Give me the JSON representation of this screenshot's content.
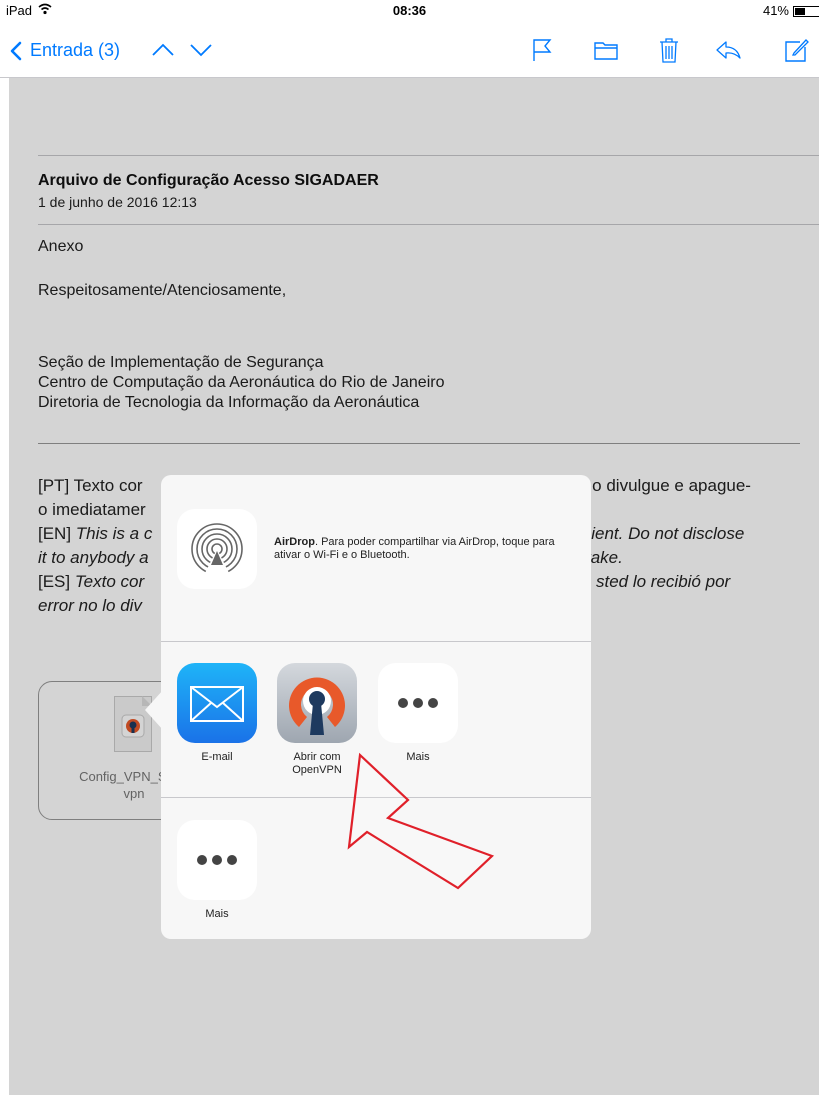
{
  "status_bar": {
    "carrier": "iPad",
    "time": "08:36",
    "battery": "41%"
  },
  "nav": {
    "back_label": "Entrada (3)",
    "icons": [
      "chevron-left-icon",
      "chevron-up-icon",
      "chevron-down-icon",
      "flag-icon",
      "folder-icon",
      "trash-icon",
      "reply-icon",
      "compose-icon"
    ]
  },
  "email": {
    "subject": "Arquivo de Configuração Acesso SIGADAER",
    "date": "1 de junho de 2016 12:13",
    "body": [
      "Anexo",
      "Respeitosamente/Atenciosamente,"
    ],
    "signature": [
      "Seção de Implementação de Segurança",
      "Centro de Computação da Aeronáutica do Rio de Janeiro",
      "Diretoria de Tecnologia da Informação da Aeronáutica"
    ],
    "disclaimer": {
      "pt_1": "[PT] Texto cor",
      "pt_right": "o o divulgue e apague-",
      "pt_2": "o imediatamer",
      "en_tag": "[EN]",
      "en_1": "This is a c",
      "en_right": "ipient. Do not disclose",
      "en_2": "it to anybody a",
      "en_right2": "take.",
      "es_tag": "[ES]",
      "es_1": "Texto cor",
      "es_right": "sted lo recibió por",
      "es_2": "error no lo div"
    },
    "attachment": {
      "name_line1": "Config_VPN_SIGA",
      "name_line2": "vpn"
    }
  },
  "share_sheet": {
    "airdrop_title": "AirDrop",
    "airdrop_text": ". Para poder compartilhar via AirDrop, toque para ativar o Wi-Fi e o Bluetooth.",
    "apps": [
      {
        "label": "E-mail",
        "icon": "mail-icon"
      },
      {
        "label_line1": "Abrir com",
        "label_line2": "OpenVPN",
        "icon": "openvpn-icon"
      },
      {
        "label": "Mais",
        "icon": "more-icon"
      }
    ],
    "actions": [
      {
        "label": "Mais",
        "icon": "more-icon"
      }
    ]
  },
  "colors": {
    "accent": "#007aff",
    "annotation_arrow": "#e0202a",
    "openvpn_orange": "#e8592a",
    "openvpn_navy": "#1e3a5f"
  }
}
